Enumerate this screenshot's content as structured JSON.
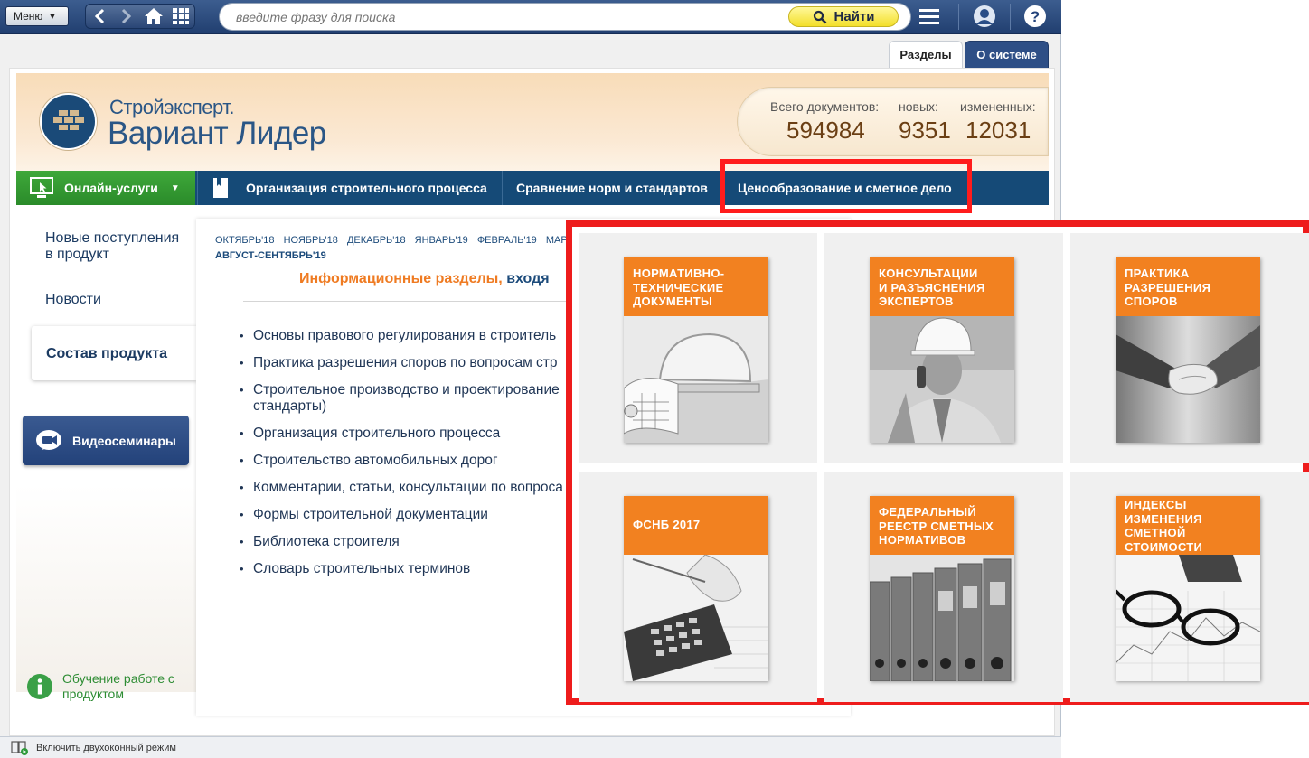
{
  "topbar": {
    "menu_label": "Меню",
    "search_placeholder": "введите фразу для поиска",
    "find_label": "Найти"
  },
  "tabs": [
    "Разделы",
    "О системе"
  ],
  "header": {
    "brand_line1": "Стройэксперт.",
    "brand_line2": "Вариант Лидер",
    "stats": [
      {
        "label": "Всего документов:",
        "value": "594984"
      },
      {
        "label": "новых:",
        "value": "9351"
      },
      {
        "label": "измененных:",
        "value": "12031"
      }
    ]
  },
  "nav": {
    "online": "Онлайн-услуги",
    "items": [
      "Организация строительного процесса",
      "Сравнение норм и стандартов",
      "Ценообразование и сметное дело"
    ]
  },
  "sidebar": {
    "new_items": "Новые поступления в продукт",
    "news": "Новости",
    "composition": "Состав продукта",
    "video": "Видеосеминары",
    "training": "Обучение работе с продуктом"
  },
  "content": {
    "months": [
      "ОКТЯБРЬ'18",
      "НОЯБРЬ'18",
      "ДЕКАБРЬ'18",
      "ЯНВАРЬ'19",
      "ФЕВРАЛЬ'19",
      "МАР"
    ],
    "months_row2": "АВГУСТ-СЕНТЯБРЬ'19",
    "info_title_orange": "Информационные разделы,",
    "info_title_blue": "входя",
    "bullets": [
      "Основы правового регулирования в строитель",
      "Практика разрешения споров по вопросам стр",
      "Строительное производство и проектирование стандарты)",
      "Организация строительного процесса",
      "Строительство автомобильных дорог",
      "Комментарии, статьи, консультации по вопроса",
      "Формы строительной документации",
      "Библиотека строителя",
      "Словарь строительных терминов"
    ]
  },
  "status_bar": "Включить двухоконный режим",
  "tiles": [
    {
      "title": "НОРМАТИВНО-\nТЕХНИЧЕСКИЕ\nДОКУМЕНТЫ",
      "image": "hardhat-blueprints"
    },
    {
      "title": "КОНСУЛЬТАЦИИ\nИ РАЗЪЯСНЕНИЯ\nЭКСПЕРТОВ",
      "image": "engineer-phone"
    },
    {
      "title": "ПРАКТИКА\nРАЗРЕШЕНИЯ\nСПОРОВ",
      "image": "handshake"
    },
    {
      "title": "ФСНБ 2017",
      "image": "calculator"
    },
    {
      "title": "ФЕДЕРАЛЬНЫЙ\nРЕЕСТР СМЕТНЫХ\nНОРМАТИВОВ",
      "image": "binders"
    },
    {
      "title": "ИНДЕКСЫ\nИЗМЕНЕНИЯ\nСМЕТНОЙ\nСТОИМОСТИ",
      "image": "glasses-chart"
    }
  ],
  "colors": {
    "accent_orange": "#f28120",
    "nav_blue": "#154a77",
    "highlight_red": "#ee1c1c",
    "online_green": "#3fa83a"
  }
}
